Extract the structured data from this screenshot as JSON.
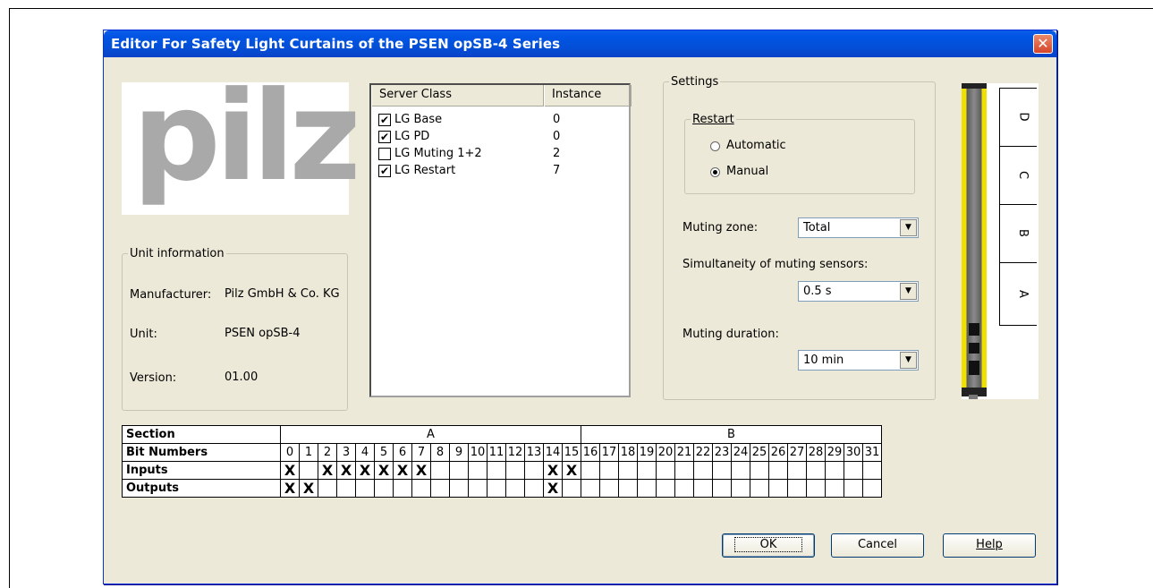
{
  "window": {
    "title": "Editor For Safety Light Curtains of the PSEN opSB-4 Series",
    "close_glyph": "✕"
  },
  "logo": {
    "text": "pilz"
  },
  "unit_info": {
    "title": "Unit information",
    "manufacturer_label": "Manufacturer:",
    "manufacturer_value": "Pilz GmbH & Co. KG",
    "unit_label": "Unit:",
    "unit_value": "PSEN opSB-4",
    "version_label": "Version:",
    "version_value": "01.00"
  },
  "server_list": {
    "headers": [
      "Server Class",
      "Instance"
    ],
    "rows": [
      {
        "name": "LG Base",
        "instance": "0",
        "checked": true
      },
      {
        "name": "LG PD",
        "instance": "0",
        "checked": true
      },
      {
        "name": "LG Muting 1+2",
        "instance": "2",
        "checked": false
      },
      {
        "name": "LG Restart",
        "instance": "7",
        "checked": true
      }
    ]
  },
  "settings": {
    "title": "Settings",
    "restart": {
      "title": "Restart",
      "options": [
        {
          "label": "Automatic",
          "selected": false
        },
        {
          "label": "Manual",
          "selected": true
        }
      ]
    },
    "muting_zone_label": "Muting zone:",
    "muting_zone_value": "Total",
    "simultaneity_label": "Simultaneity of muting sensors:",
    "simultaneity_value": "0.5 s",
    "muting_duration_label": "Muting duration:",
    "muting_duration_value": "10 min"
  },
  "curtain": {
    "zones": [
      "D",
      "C",
      "B",
      "A"
    ]
  },
  "bit_table": {
    "section_label": "Section",
    "bit_numbers_label": "Bit Numbers",
    "inputs_label": "Inputs",
    "outputs_label": "Outputs",
    "section_a": "A",
    "section_b": "B",
    "bits": [
      "0",
      "1",
      "2",
      "3",
      "4",
      "5",
      "6",
      "7",
      "8",
      "9",
      "10",
      "11",
      "12",
      "13",
      "14",
      "15",
      "16",
      "17",
      "18",
      "19",
      "20",
      "21",
      "22",
      "23",
      "24",
      "25",
      "26",
      "27",
      "28",
      "29",
      "30",
      "31"
    ],
    "inputs": [
      "X",
      "",
      "X",
      "X",
      "X",
      "X",
      "X",
      "X",
      "",
      "",
      "",
      "",
      "",
      "",
      "X",
      "X",
      "",
      "",
      "",
      "",
      "",
      "",
      "",
      "",
      "",
      "",
      "",
      "",
      "",
      "",
      "",
      ""
    ],
    "outputs": [
      "X",
      "X",
      "",
      "",
      "",
      "",
      "",
      "",
      "",
      "",
      "",
      "",
      "",
      "",
      "X",
      "",
      "",
      "",
      "",
      "",
      "",
      "",
      "",
      "",
      "",
      "",
      "",
      "",
      "",
      "",
      "",
      ""
    ]
  },
  "buttons": {
    "ok": "OK",
    "cancel": "Cancel",
    "help": "Help"
  },
  "colors": {
    "title_bar": "#0054e3",
    "dialog_bg": "#ece9d8",
    "curtain_yellow": "#f0e000"
  }
}
